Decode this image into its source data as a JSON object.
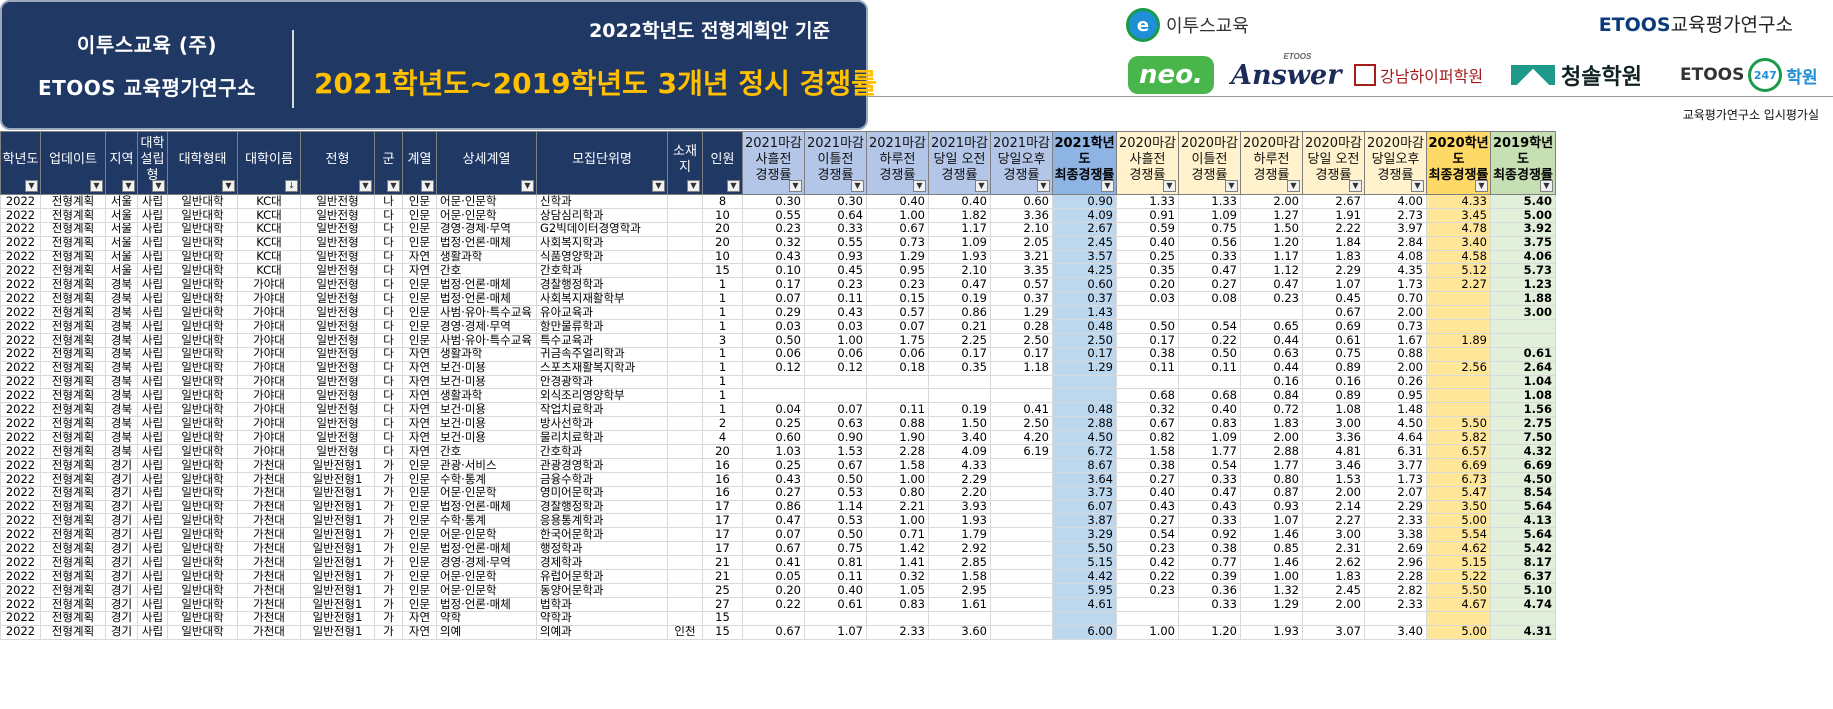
{
  "banner": {
    "org_line1": "이투스교육 (주)",
    "org_line2": "ETOOS 교육평가연구소",
    "basis": "2022학년도 전형계획안 기준",
    "title": "2021학년도~2019학년도  3개년 정시 경쟁률"
  },
  "logos": {
    "etoos_top": "이투스교육",
    "etoos_mark": "e",
    "institute_brand": "ETOOS",
    "institute_sub": "교육평가연구소",
    "neo": "neo.",
    "answer": "Answer",
    "answer_small": "ETOOS",
    "gangnam": "강남하이퍼학원",
    "cheongsol": "청솔학원",
    "etoos247_brand": "ETOOS",
    "etoos247_num": "247",
    "etoos247_suffix": "학원"
  },
  "dept_label": "교육평가연구소 입시평가실",
  "colors": {
    "navy": "#1f3864",
    "title_gold": "#ffc000",
    "blue_col": "#bdd7ee",
    "yellow_col": "#ffe699",
    "green_col": "#e2efda"
  },
  "columns": [
    {
      "label": "학년도",
      "cls": "blk"
    },
    {
      "label": "업데이트",
      "cls": "blk"
    },
    {
      "label": "지역",
      "cls": "blk"
    },
    {
      "label": "대학\n설립\n형",
      "cls": "blk"
    },
    {
      "label": "대학형태",
      "cls": "blk"
    },
    {
      "label": "대학이름",
      "cls": "blk",
      "sorted": true
    },
    {
      "label": "전형",
      "cls": "blk"
    },
    {
      "label": "군",
      "cls": "blk"
    },
    {
      "label": "계열",
      "cls": "blk"
    },
    {
      "label": "상세계열",
      "cls": "blk"
    },
    {
      "label": "모집단위명",
      "cls": "blk"
    },
    {
      "label": "소재\n지",
      "cls": "blk"
    },
    {
      "label": "인원",
      "cls": "blk"
    },
    {
      "label": "2021마감\n사흘전\n경쟁률",
      "cls": "lb"
    },
    {
      "label": "2021마감\n이틀전\n경쟁률",
      "cls": "lb"
    },
    {
      "label": "2021마감\n하루전\n경쟁률",
      "cls": "lb"
    },
    {
      "label": "2021마감\n당일 오전\n경쟁률",
      "cls": "lb"
    },
    {
      "label": "2021마감\n당일오후\n경쟁률",
      "cls": "lb"
    },
    {
      "label": "2021학년도\n최종경쟁률",
      "cls": "db"
    },
    {
      "label": "2020마감\n사흘전\n경쟁률",
      "cls": "ly"
    },
    {
      "label": "2020마감\n이틀전\n경쟁률",
      "cls": "ly"
    },
    {
      "label": "2020마감\n하루전\n경쟁률",
      "cls": "ly"
    },
    {
      "label": "2020마감\n당일 오전\n경쟁률",
      "cls": "ly"
    },
    {
      "label": "2020마감\n당일오후\n경쟁률",
      "cls": "ly"
    },
    {
      "label": "2020학년도\n최종경쟁률",
      "cls": "dy"
    },
    {
      "label": "2019학년도\n최종경쟁률",
      "cls": "lg"
    }
  ],
  "rows": [
    [
      "2022",
      "전형계획",
      "서울",
      "사립",
      "일반대학",
      "KC대",
      "일반전형",
      "나",
      "인문",
      "어문·인문학",
      "신학과",
      "",
      "8",
      "0.30",
      "0.30",
      "0.40",
      "0.40",
      "0.60",
      "0.90",
      "1.33",
      "1.33",
      "2.00",
      "2.67",
      "4.00",
      "4.33",
      "5.40"
    ],
    [
      "2022",
      "전형계획",
      "서울",
      "사립",
      "일반대학",
      "KC대",
      "일반전형",
      "다",
      "인문",
      "어문·인문학",
      "상담심리학과",
      "",
      "10",
      "0.55",
      "0.64",
      "1.00",
      "1.82",
      "3.36",
      "4.09",
      "0.91",
      "1.09",
      "1.27",
      "1.91",
      "2.73",
      "3.45",
      "5.00"
    ],
    [
      "2022",
      "전형계획",
      "서울",
      "사립",
      "일반대학",
      "KC대",
      "일반전형",
      "다",
      "인문",
      "경영·경제·무역",
      "G2빅데이터경영학과",
      "",
      "20",
      "0.23",
      "0.33",
      "0.67",
      "1.17",
      "2.10",
      "2.67",
      "0.59",
      "0.75",
      "1.50",
      "2.22",
      "3.97",
      "4.78",
      "3.92"
    ],
    [
      "2022",
      "전형계획",
      "서울",
      "사립",
      "일반대학",
      "KC대",
      "일반전형",
      "다",
      "인문",
      "법정·언론·매체",
      "사회복지학과",
      "",
      "20",
      "0.32",
      "0.55",
      "0.73",
      "1.09",
      "2.05",
      "2.45",
      "0.40",
      "0.56",
      "1.20",
      "1.84",
      "2.84",
      "3.40",
      "3.75"
    ],
    [
      "2022",
      "전형계획",
      "서울",
      "사립",
      "일반대학",
      "KC대",
      "일반전형",
      "다",
      "자연",
      "생활과학",
      "식품영양학과",
      "",
      "10",
      "0.43",
      "0.93",
      "1.29",
      "1.93",
      "3.21",
      "3.57",
      "0.25",
      "0.33",
      "1.17",
      "1.83",
      "4.08",
      "4.58",
      "4.06"
    ],
    [
      "2022",
      "전형계획",
      "서울",
      "사립",
      "일반대학",
      "KC대",
      "일반전형",
      "다",
      "자연",
      "간호",
      "간호학과",
      "",
      "15",
      "0.10",
      "0.45",
      "0.95",
      "2.10",
      "3.35",
      "4.25",
      "0.35",
      "0.47",
      "1.12",
      "2.29",
      "4.35",
      "5.12",
      "5.73"
    ],
    [
      "2022",
      "전형계획",
      "경북",
      "사립",
      "일반대학",
      "가야대",
      "일반전형",
      "다",
      "인문",
      "법정·언론·매체",
      "경찰행정학과",
      "",
      "1",
      "0.17",
      "0.23",
      "0.23",
      "0.47",
      "0.57",
      "0.60",
      "0.20",
      "0.27",
      "0.47",
      "1.07",
      "1.73",
      "2.27",
      "1.23"
    ],
    [
      "2022",
      "전형계획",
      "경북",
      "사립",
      "일반대학",
      "가야대",
      "일반전형",
      "다",
      "인문",
      "법정·언론·매체",
      "사회복지재활학부",
      "",
      "1",
      "0.07",
      "0.11",
      "0.15",
      "0.19",
      "0.37",
      "0.37",
      "0.03",
      "0.08",
      "0.23",
      "0.45",
      "0.70",
      "",
      "1.88"
    ],
    [
      "2022",
      "전형계획",
      "경북",
      "사립",
      "일반대학",
      "가야대",
      "일반전형",
      "다",
      "인문",
      "사범·유아·특수교육",
      "유아교육과",
      "",
      "1",
      "0.29",
      "0.43",
      "0.57",
      "0.86",
      "1.29",
      "1.43",
      "",
      "",
      "",
      "0.67",
      "2.00",
      "",
      "3.00"
    ],
    [
      "2022",
      "전형계획",
      "경북",
      "사립",
      "일반대학",
      "가야대",
      "일반전형",
      "다",
      "인문",
      "경영·경제·무역",
      "항만물류학과",
      "",
      "1",
      "0.03",
      "0.03",
      "0.07",
      "0.21",
      "0.28",
      "0.48",
      "0.50",
      "0.54",
      "0.65",
      "0.69",
      "0.73",
      "",
      ""
    ],
    [
      "2022",
      "전형계획",
      "경북",
      "사립",
      "일반대학",
      "가야대",
      "일반전형",
      "다",
      "인문",
      "사범·유아·특수교육",
      "특수교육과",
      "",
      "3",
      "0.50",
      "1.00",
      "1.75",
      "2.25",
      "2.50",
      "2.50",
      "0.17",
      "0.22",
      "0.44",
      "0.61",
      "1.67",
      "1.89",
      ""
    ],
    [
      "2022",
      "전형계획",
      "경북",
      "사립",
      "일반대학",
      "가야대",
      "일반전형",
      "다",
      "자연",
      "생활과학",
      "귀금속주얼리학과",
      "",
      "1",
      "0.06",
      "0.06",
      "0.06",
      "0.17",
      "0.17",
      "0.17",
      "0.38",
      "0.50",
      "0.63",
      "0.75",
      "0.88",
      "",
      "0.61"
    ],
    [
      "2022",
      "전형계획",
      "경북",
      "사립",
      "일반대학",
      "가야대",
      "일반전형",
      "다",
      "자연",
      "보건·미용",
      "스포츠재활복지학과",
      "",
      "1",
      "0.12",
      "0.12",
      "0.18",
      "0.35",
      "1.18",
      "1.29",
      "0.11",
      "0.11",
      "0.44",
      "0.89",
      "2.00",
      "2.56",
      "2.64"
    ],
    [
      "2022",
      "전형계획",
      "경북",
      "사립",
      "일반대학",
      "가야대",
      "일반전형",
      "다",
      "자연",
      "보건·미용",
      "안경광학과",
      "",
      "1",
      "",
      "",
      "",
      "",
      "",
      "",
      "",
      "",
      "0.16",
      "0.16",
      "0.26",
      "",
      "1.04"
    ],
    [
      "2022",
      "전형계획",
      "경북",
      "사립",
      "일반대학",
      "가야대",
      "일반전형",
      "다",
      "자연",
      "생활과학",
      "외식조리영양학부",
      "",
      "1",
      "",
      "",
      "",
      "",
      "",
      "",
      "0.68",
      "0.68",
      "0.84",
      "0.89",
      "0.95",
      "",
      "1.08"
    ],
    [
      "2022",
      "전형계획",
      "경북",
      "사립",
      "일반대학",
      "가야대",
      "일반전형",
      "다",
      "자연",
      "보건·미용",
      "작업치료학과",
      "",
      "1",
      "0.04",
      "0.07",
      "0.11",
      "0.19",
      "0.41",
      "0.48",
      "0.32",
      "0.40",
      "0.72",
      "1.08",
      "1.48",
      "",
      "1.56"
    ],
    [
      "2022",
      "전형계획",
      "경북",
      "사립",
      "일반대학",
      "가야대",
      "일반전형",
      "다",
      "자연",
      "보건·미용",
      "방사선학과",
      "",
      "2",
      "0.25",
      "0.63",
      "0.88",
      "1.50",
      "2.50",
      "2.88",
      "0.67",
      "0.83",
      "1.83",
      "3.00",
      "4.50",
      "5.50",
      "2.75"
    ],
    [
      "2022",
      "전형계획",
      "경북",
      "사립",
      "일반대학",
      "가야대",
      "일반전형",
      "다",
      "자연",
      "보건·미용",
      "물리치료학과",
      "",
      "4",
      "0.60",
      "0.90",
      "1.90",
      "3.40",
      "4.20",
      "4.50",
      "0.82",
      "1.09",
      "2.00",
      "3.36",
      "4.64",
      "5.82",
      "7.50"
    ],
    [
      "2022",
      "전형계획",
      "경북",
      "사립",
      "일반대학",
      "가야대",
      "일반전형",
      "다",
      "자연",
      "간호",
      "간호학과",
      "",
      "20",
      "1.03",
      "1.53",
      "2.28",
      "4.09",
      "6.19",
      "6.72",
      "1.58",
      "1.77",
      "2.88",
      "4.81",
      "6.31",
      "6.57",
      "4.32"
    ],
    [
      "2022",
      "전형계획",
      "경기",
      "사립",
      "일반대학",
      "가천대",
      "일반전형1",
      "가",
      "인문",
      "관광·서비스",
      "관광경영학과",
      "",
      "16",
      "0.25",
      "0.67",
      "1.58",
      "4.33",
      "",
      "8.67",
      "0.38",
      "0.54",
      "1.77",
      "3.46",
      "3.77",
      "6.69",
      "6.69"
    ],
    [
      "2022",
      "전형계획",
      "경기",
      "사립",
      "일반대학",
      "가천대",
      "일반전형1",
      "가",
      "인문",
      "수학·통계",
      "금융수학과",
      "",
      "16",
      "0.43",
      "0.50",
      "1.00",
      "2.29",
      "",
      "3.64",
      "0.27",
      "0.33",
      "0.80",
      "1.53",
      "1.73",
      "6.73",
      "4.50"
    ],
    [
      "2022",
      "전형계획",
      "경기",
      "사립",
      "일반대학",
      "가천대",
      "일반전형1",
      "가",
      "인문",
      "어문·인문학",
      "영미어문학과",
      "",
      "16",
      "0.27",
      "0.53",
      "0.80",
      "2.20",
      "",
      "3.73",
      "0.40",
      "0.47",
      "0.87",
      "2.00",
      "2.07",
      "5.47",
      "8.54"
    ],
    [
      "2022",
      "전형계획",
      "경기",
      "사립",
      "일반대학",
      "가천대",
      "일반전형1",
      "가",
      "인문",
      "법정·언론·매체",
      "경찰행정학과",
      "",
      "17",
      "0.86",
      "1.14",
      "2.21",
      "3.93",
      "",
      "6.07",
      "0.43",
      "0.43",
      "0.93",
      "2.14",
      "2.29",
      "3.50",
      "5.64"
    ],
    [
      "2022",
      "전형계획",
      "경기",
      "사립",
      "일반대학",
      "가천대",
      "일반전형1",
      "가",
      "인문",
      "수학·통계",
      "응용통계학과",
      "",
      "17",
      "0.47",
      "0.53",
      "1.00",
      "1.93",
      "",
      "3.87",
      "0.27",
      "0.33",
      "1.07",
      "2.27",
      "2.33",
      "5.00",
      "4.13"
    ],
    [
      "2022",
      "전형계획",
      "경기",
      "사립",
      "일반대학",
      "가천대",
      "일반전형1",
      "가",
      "인문",
      "어문·인문학",
      "한국어문학과",
      "",
      "17",
      "0.07",
      "0.50",
      "0.71",
      "1.79",
      "",
      "3.29",
      "0.54",
      "0.92",
      "1.46",
      "3.00",
      "3.38",
      "5.54",
      "5.64"
    ],
    [
      "2022",
      "전형계획",
      "경기",
      "사립",
      "일반대학",
      "가천대",
      "일반전형1",
      "가",
      "인문",
      "법정·언론·매체",
      "행정학과",
      "",
      "17",
      "0.67",
      "0.75",
      "1.42",
      "2.92",
      "",
      "5.50",
      "0.23",
      "0.38",
      "0.85",
      "2.31",
      "2.69",
      "4.62",
      "5.42"
    ],
    [
      "2022",
      "전형계획",
      "경기",
      "사립",
      "일반대학",
      "가천대",
      "일반전형1",
      "가",
      "인문",
      "경영·경제·무역",
      "경제학과",
      "",
      "21",
      "0.41",
      "0.81",
      "1.41",
      "2.85",
      "",
      "5.15",
      "0.42",
      "0.77",
      "1.46",
      "2.62",
      "2.96",
      "5.15",
      "8.17"
    ],
    [
      "2022",
      "전형계획",
      "경기",
      "사립",
      "일반대학",
      "가천대",
      "일반전형1",
      "가",
      "인문",
      "어문·인문학",
      "유럽어문학과",
      "",
      "21",
      "0.05",
      "0.11",
      "0.32",
      "1.58",
      "",
      "4.42",
      "0.22",
      "0.39",
      "1.00",
      "1.83",
      "2.28",
      "5.22",
      "6.37"
    ],
    [
      "2022",
      "전형계획",
      "경기",
      "사립",
      "일반대학",
      "가천대",
      "일반전형1",
      "가",
      "인문",
      "어문·인문학",
      "동양어문학과",
      "",
      "25",
      "0.20",
      "0.40",
      "1.05",
      "2.95",
      "",
      "5.95",
      "0.23",
      "0.36",
      "1.32",
      "2.45",
      "2.82",
      "5.50",
      "5.10"
    ],
    [
      "2022",
      "전형계획",
      "경기",
      "사립",
      "일반대학",
      "가천대",
      "일반전형1",
      "가",
      "인문",
      "법정·언론·매체",
      "법학과",
      "",
      "27",
      "0.22",
      "0.61",
      "0.83",
      "1.61",
      "",
      "4.61",
      "",
      "0.33",
      "1.29",
      "2.00",
      "2.33",
      "4.67",
      "4.74"
    ],
    [
      "2022",
      "전형계획",
      "경기",
      "사립",
      "일반대학",
      "가천대",
      "일반전형1",
      "가",
      "자연",
      "약학",
      "약학과",
      "",
      "15",
      "",
      "",
      "",
      "",
      "",
      "",
      "",
      "",
      "",
      "",
      "",
      "",
      ""
    ],
    [
      "2022",
      "전형계획",
      "경기",
      "사립",
      "일반대학",
      "가천대",
      "일반전형1",
      "가",
      "자연",
      "의예",
      "의예과",
      "인천",
      "15",
      "0.67",
      "1.07",
      "2.33",
      "3.60",
      "",
      "6.00",
      "1.00",
      "1.20",
      "1.93",
      "3.07",
      "3.40",
      "5.00",
      "4.31"
    ]
  ]
}
